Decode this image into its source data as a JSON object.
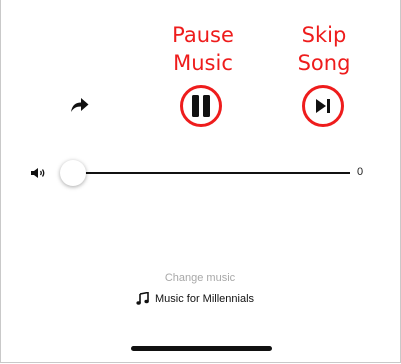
{
  "annotations": {
    "pause_line1": "Pause",
    "pause_line2": "Music",
    "skip_line1": "Skip",
    "skip_line2": "Song",
    "color": "#ee1c1c"
  },
  "controls": {
    "share_icon": "share-arrow-icon",
    "pause_icon": "pause-icon",
    "skip_icon": "skip-next-icon"
  },
  "volume": {
    "icon": "speaker-icon",
    "value": "0",
    "level": 0
  },
  "music": {
    "change_label": "Change music",
    "playlist_icon": "music-note-icon",
    "playlist_name": "Music for Millennials"
  }
}
